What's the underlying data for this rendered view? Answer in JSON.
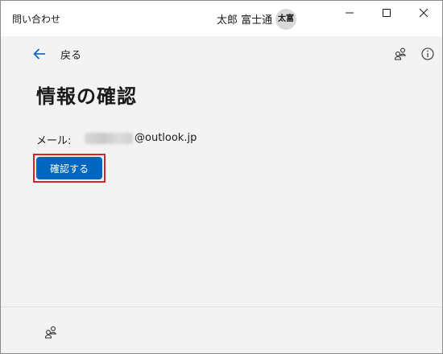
{
  "window": {
    "app_title": "問い合わせ",
    "user_name": "太郎 富士通",
    "avatar_initials": "太富",
    "controls": [
      "minimize-icon",
      "maximize-icon",
      "close-icon"
    ]
  },
  "nav": {
    "back_label": "戻る",
    "back_icon": "arrow-left-icon",
    "header_icons": [
      "people-community-icon",
      "info-icon"
    ]
  },
  "content": {
    "title": "情報の確認",
    "email_label": "メール:",
    "email_domain": "@outlook.jp",
    "confirm_button": "確認する"
  },
  "footer": {
    "icon": "people-community-icon"
  },
  "colors": {
    "accent": "#0067c0",
    "highlight": "#d9202b",
    "background": "#f3f3f3",
    "titlebar": "#ffffff"
  }
}
